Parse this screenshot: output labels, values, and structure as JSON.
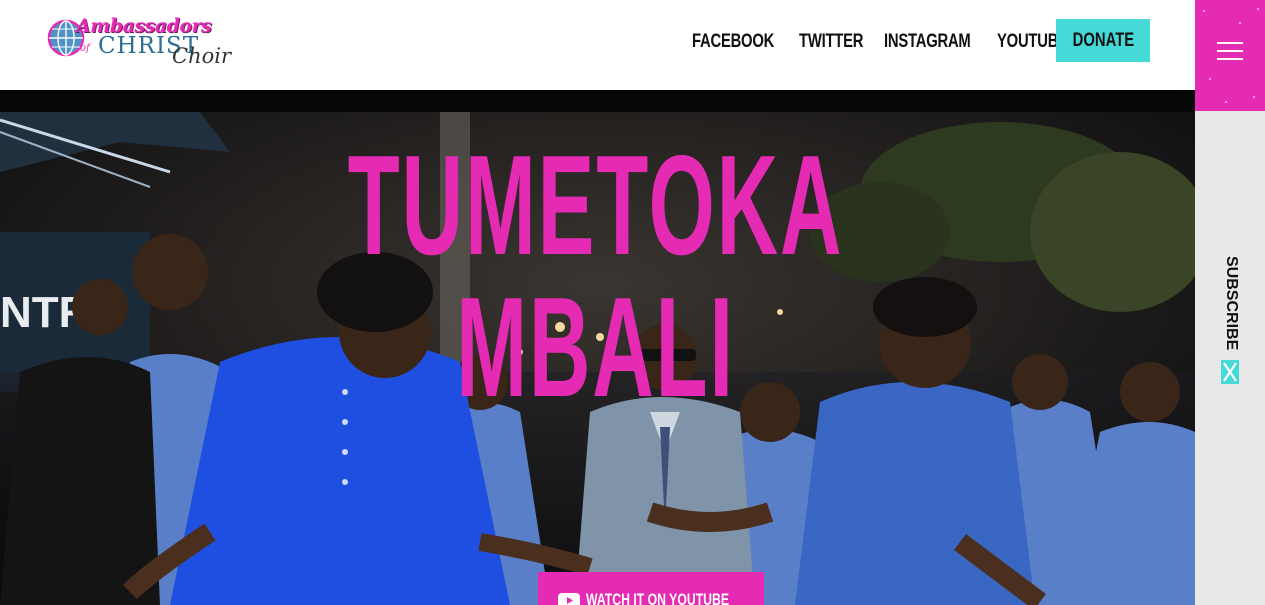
{
  "header": {
    "logo": {
      "line1": "Ambassadors",
      "of": "of",
      "christ": "CHRIST",
      "choir": "Choir"
    },
    "nav": [
      {
        "label": "FACEBOOK"
      },
      {
        "label": "TWITTER"
      },
      {
        "label": "INSTAGRAM"
      },
      {
        "label": "YOUTUBE"
      }
    ],
    "donate_label": "DONATE"
  },
  "sidebar": {
    "menu_icon": "hamburger-menu-icon",
    "subscribe_label": "SUBSCRIBE",
    "subscribe_icon": "close-x-icon"
  },
  "hero": {
    "title": "TUMETOKA MBALI",
    "watch_label": "WATCH IT ON YOUTUBE",
    "watch_icon": "youtube-icon"
  },
  "colors": {
    "brand_pink": "#e52bb4",
    "accent_teal": "#45d9d8",
    "rail_gray": "#e8e8e8",
    "logo_blue": "#2b6f93"
  }
}
